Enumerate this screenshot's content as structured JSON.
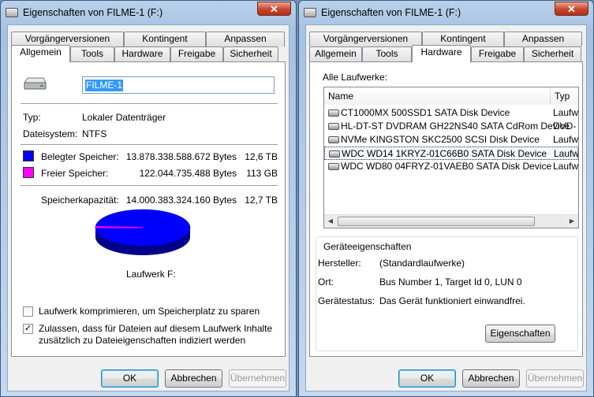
{
  "left": {
    "title": "Eigenschaften von FILME-1 (F:)",
    "close_label": "✕",
    "tabs_row1": [
      "Vorgängerversionen",
      "Kontingent",
      "Anpassen"
    ],
    "tabs_row2": [
      "Allgemein",
      "Tools",
      "Hardware",
      "Freigabe",
      "Sicherheit"
    ],
    "selected_tab": "Allgemein",
    "drive_name": "FILME-1",
    "type_label": "Typ:",
    "type_value": "Lokaler Datenträger",
    "fs_label": "Dateisystem:",
    "fs_value": "NTFS",
    "used_label": "Belegter Speicher:",
    "used_bytes": "13.878.338.588.672 Bytes",
    "used_short": "12,6 TB",
    "free_label": "Freier Speicher:",
    "free_bytes": "122.044.735.488 Bytes",
    "free_short": "113 GB",
    "capacity_label": "Speicherkapazität:",
    "capacity_bytes": "14.000.383.324.160 Bytes",
    "capacity_short": "12,7 TB",
    "used_fraction": 0.9913,
    "drive_label": "Laufwerk F:",
    "compress_label": "Laufwerk komprimieren, um Speicherplatz zu sparen",
    "compress_checked": false,
    "index_label_line1": "Zulassen, dass für Dateien auf diesem Laufwerk Inhalte",
    "index_label_line2": "zusätzlich zu Dateieigenschaften indiziert werden",
    "index_checked": true,
    "checkmark": "✓",
    "ok": "OK",
    "cancel": "Abbrechen",
    "apply": "Übernehmen"
  },
  "right": {
    "title": "Eigenschaften von FILME-1 (F:)",
    "close_label": "✕",
    "tabs_row1": [
      "Vorgängerversionen",
      "Kontingent",
      "Anpassen"
    ],
    "tabs_row2": [
      "Allgemein",
      "Tools",
      "Hardware",
      "Freigabe",
      "Sicherheit"
    ],
    "selected_tab": "Hardware",
    "all_drives_label": "Alle Laufwerke:",
    "col_name": "Name",
    "col_type": "Typ",
    "drives": [
      {
        "name": "CT1000MX 500SSD1 SATA Disk Device",
        "type": "Laufw"
      },
      {
        "name": "HL-DT-ST DVDRAM GH22NS40 SATA CdRom Device",
        "type": "DVD-"
      },
      {
        "name": "NVMe KINGSTON SKC2500 SCSI Disk Device",
        "type": "Laufw"
      },
      {
        "name": "WDC WD14 1KRYZ-01C66B0 SATA Disk Device",
        "type": "Laufw"
      },
      {
        "name": "WDC WD80 04FRYZ-01VAEB0 SATA Disk Device",
        "type": "Laufw"
      }
    ],
    "selected_drive_index": 3,
    "scroll_left": "◀",
    "scroll_right": "▶",
    "props_group": "Geräteeigenschaften",
    "manufacturer_label": "Hersteller:",
    "manufacturer_value": "(Standardlaufwerke)",
    "location_label": "Ort:",
    "location_value": "Bus Number 1, Target Id 0, LUN 0",
    "status_label": "Gerätestatus:",
    "status_value": "Das Gerät funktioniert einwandfrei.",
    "properties_button": "Eigenschaften",
    "ok": "OK",
    "cancel": "Abbrechen",
    "apply": "Übernehmen"
  },
  "colors": {
    "used": "#0000ff",
    "free": "#ff00ff",
    "used_dark": "#00008b"
  }
}
